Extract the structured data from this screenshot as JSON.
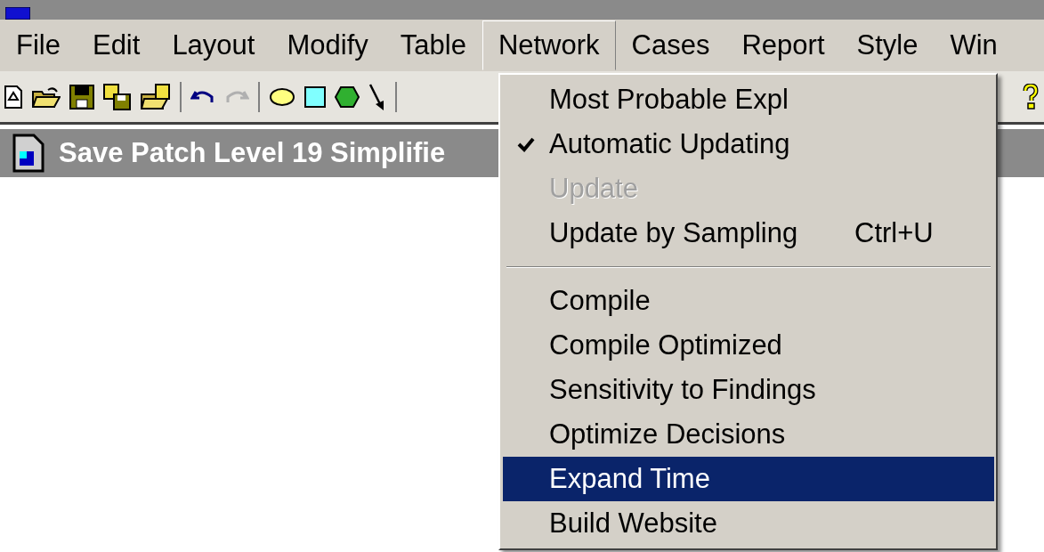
{
  "menubar": [
    {
      "label": "File",
      "selected": false
    },
    {
      "label": "Edit",
      "selected": false
    },
    {
      "label": "Layout",
      "selected": false
    },
    {
      "label": "Modify",
      "selected": false
    },
    {
      "label": "Table",
      "selected": false
    },
    {
      "label": "Network",
      "selected": true
    },
    {
      "label": "Cases",
      "selected": false
    },
    {
      "label": "Report",
      "selected": false
    },
    {
      "label": "Style",
      "selected": false
    },
    {
      "label": "Win",
      "selected": false
    }
  ],
  "document": {
    "title": "Save Patch Level 19 Simplifie"
  },
  "network_menu": [
    {
      "kind": "item",
      "label": "Most Probable Expl",
      "checked": false,
      "disabled": false,
      "selected": false
    },
    {
      "kind": "item",
      "label": "Automatic Updating",
      "checked": true,
      "disabled": false,
      "selected": false
    },
    {
      "kind": "item",
      "label": "Update",
      "checked": false,
      "disabled": true,
      "selected": false
    },
    {
      "kind": "item",
      "label": "Update by Sampling",
      "shortcut": "Ctrl+U",
      "checked": false,
      "disabled": false,
      "selected": false
    },
    {
      "kind": "separator"
    },
    {
      "kind": "item",
      "label": "Compile",
      "checked": false,
      "disabled": false,
      "selected": false
    },
    {
      "kind": "item",
      "label": "Compile Optimized",
      "checked": false,
      "disabled": false,
      "selected": false
    },
    {
      "kind": "item",
      "label": "Sensitivity to Findings",
      "checked": false,
      "disabled": false,
      "selected": false
    },
    {
      "kind": "item",
      "label": "Optimize Decisions",
      "checked": false,
      "disabled": false,
      "selected": false
    },
    {
      "kind": "item",
      "label": "Expand Time",
      "checked": false,
      "disabled": false,
      "selected": true
    },
    {
      "kind": "item",
      "label": "Build Website",
      "checked": false,
      "disabled": false,
      "selected": false
    }
  ]
}
